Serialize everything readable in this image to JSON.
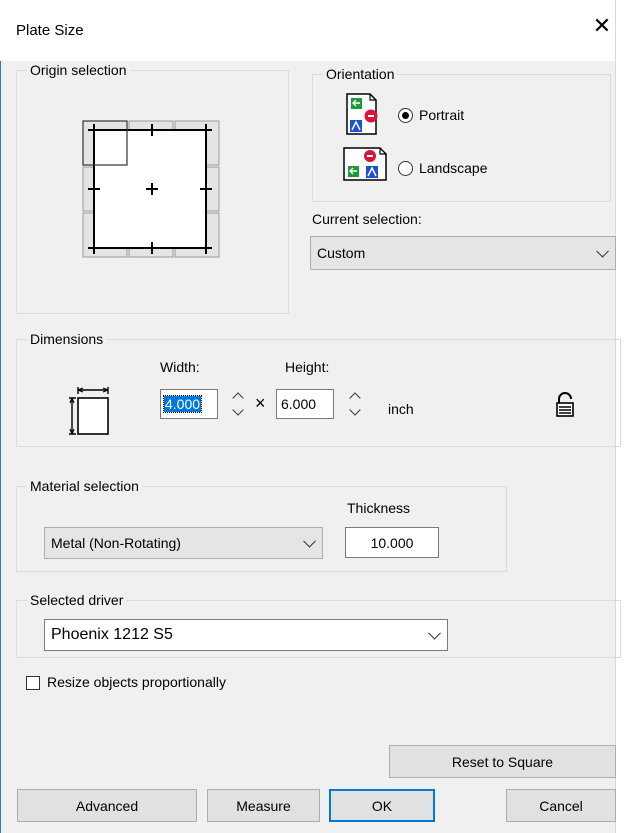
{
  "window": {
    "title": "Plate Size"
  },
  "origin": {
    "legend": "Origin selection"
  },
  "orientation": {
    "legend": "Orientation",
    "portrait_label": "Portrait",
    "landscape_label": "Landscape",
    "selected": "Portrait"
  },
  "current_selection": {
    "label": "Current selection:",
    "value": "Custom"
  },
  "dimensions": {
    "legend": "Dimensions",
    "width_label": "Width:",
    "height_label": "Height:",
    "width_value": "4.000",
    "height_value": "6.000",
    "times": "×",
    "unit": "inch"
  },
  "material": {
    "legend": "Material selection",
    "value": "Metal (Non-Rotating)",
    "thickness_label": "Thickness",
    "thickness_value": "10.000"
  },
  "driver": {
    "legend": "Selected driver",
    "value": "Phoenix 1212 S5"
  },
  "resize": {
    "label": "Resize objects proportionally",
    "checked": false
  },
  "buttons": {
    "reset": "Reset to Square",
    "advanced": "Advanced",
    "measure": "Measure",
    "ok": "OK",
    "cancel": "Cancel"
  },
  "colors": {
    "accent": "#0078d7",
    "frame": "#2b78c5"
  }
}
